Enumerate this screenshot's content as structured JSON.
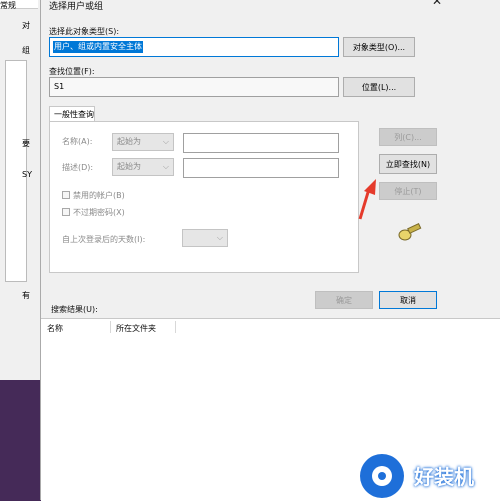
{
  "background_window": {
    "tab_label": "常规",
    "labels": [
      "对",
      "组",
      "要",
      "SY",
      "有"
    ]
  },
  "dialog": {
    "title": "选择用户或组",
    "object_type_label": "选择此对象类型(S):",
    "object_type_value": "用户、组或内置安全主体",
    "object_type_button": "对象类型(O)...",
    "location_label": "查找位置(F):",
    "location_value": "S1",
    "location_button": "位置(L)...",
    "tab_general": "一般性查询",
    "name_label": "名称(A):",
    "name_combo": "起始为",
    "desc_label": "描述(D):",
    "desc_combo": "起始为",
    "disabled_accounts": "禁用的帐户(B)",
    "no_expire_pwd": "不过期密码(X)",
    "days_since_login": "自上次登录后的天数(I):",
    "columns_button": "列(C)...",
    "find_now_button": "立即查找(N)",
    "stop_button": "停止(T)",
    "ok_button": "确定",
    "cancel_button": "取消",
    "results_label": "搜索结果(U):",
    "results_columns": [
      "名称",
      "所在文件夹"
    ]
  },
  "watermark": {
    "text": "好装机"
  },
  "colors": {
    "selection": "#0078d7",
    "arrow": "#e53a2b",
    "desktop": "#452a58"
  }
}
